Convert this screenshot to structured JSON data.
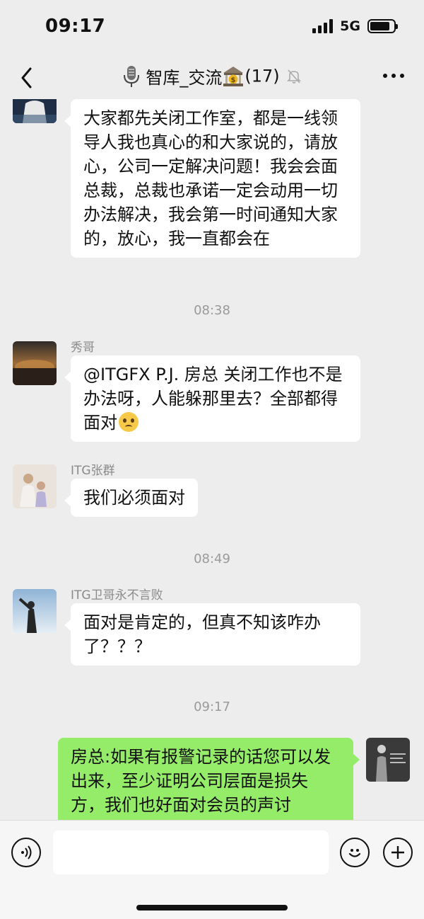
{
  "status_bar": {
    "time": "09:17",
    "network": "5G",
    "battery_percent": 85
  },
  "header": {
    "title_part1": "智库_交流",
    "member_count": "(17)",
    "icons": {
      "back": "chevron-left-icon",
      "title_lead": "microphone-icon",
      "title_trail": "bank-icon",
      "muted": "bell-muted-icon",
      "more": "ellipsis-icon"
    }
  },
  "messages": [
    {
      "type": "incoming",
      "sender": "",
      "text": "大家都先关闭工作室，都是一线领导人我也真心的和大家说的，请放心，公司一定解决问题！我会会面总裁，总裁也承诺一定会动用一切办法解决，我会第一时间通知大家的，放心，我一直都会在"
    },
    {
      "type": "time",
      "text": "08:38"
    },
    {
      "type": "incoming",
      "sender": "秀哥",
      "text": "@ITGFX P.J. 房总 关闭工作也不是办法呀，人能躲那里去？全部都得面对",
      "emoji": "pleading-face-icon"
    },
    {
      "type": "incoming",
      "sender": "ITG张群",
      "text": "我们必须面对"
    },
    {
      "type": "time",
      "text": "08:49"
    },
    {
      "type": "incoming",
      "sender": "ITG卫哥永不言败",
      "text": "面对是肯定的，但真不知该咋办了？？？"
    },
    {
      "type": "time",
      "text": "09:17"
    },
    {
      "type": "outgoing",
      "sender": "",
      "text": "房总:如果有报警记录的话您可以发出来，至少证明公司层面是损失方，我们也好面对会员的声讨"
    }
  ],
  "input_bar": {
    "placeholder": "",
    "icons": {
      "voice": "voice-icon",
      "emoji": "smile-icon",
      "plus": "plus-icon"
    }
  }
}
